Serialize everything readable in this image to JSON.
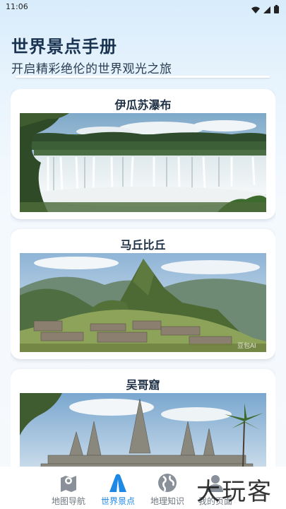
{
  "status_bar": {
    "time": "11:06"
  },
  "header": {
    "title": "世界景点手册",
    "subtitle": "开启精彩绝伦的世界观光之旅"
  },
  "attractions": [
    {
      "name": "伊瓜苏瀑布",
      "image": "iguazu-falls"
    },
    {
      "name": "马丘比丘",
      "image": "machu-picchu",
      "image_watermark": "豆包AI"
    },
    {
      "name": "吴哥窟",
      "image": "angkor-wat"
    }
  ],
  "bottom_nav": {
    "items": [
      {
        "label": "地图导航",
        "icon": "map-pin-icon",
        "active": false
      },
      {
        "label": "世界景点",
        "icon": "mountain-icon",
        "active": true
      },
      {
        "label": "地理知识",
        "icon": "globe-icon",
        "active": false
      },
      {
        "label": "我的页面",
        "icon": "person-icon",
        "active": false
      }
    ],
    "active_color": "#1e88e5",
    "inactive_color": "#6f7780"
  },
  "overlay_watermark": "大玩客"
}
